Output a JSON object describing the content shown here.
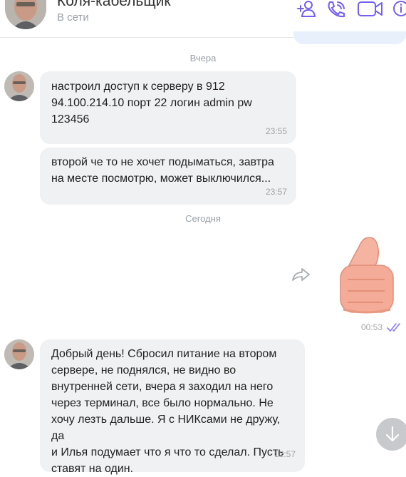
{
  "header": {
    "contact_name": "Коля-кабельщик",
    "status": "В сети",
    "icons": [
      "add-user-icon",
      "phone-icon",
      "video-icon",
      "info-icon"
    ],
    "accent_color": "#7360f2"
  },
  "dates": {
    "yesterday": "Вчера",
    "today": "Сегодня"
  },
  "messages": [
    {
      "text": "настроил доступ к серверу в 912\n94.100.214.10     порт 22     логин admin     pw\n123456",
      "time": "23:55"
    },
    {
      "text": "второй че то не хочет подыматься,   завтра\nна месте посмотрю, может выключился...",
      "time": "23:57"
    },
    {
      "text": "Добрый день! Сбросил питание на втором\nсервере, не поднялся, не видно во\nвнутренней сети, вчера я заходил на него\nчерез терминал, все было нормально. Не\nхочу лезть дальше. Я с НИКсами не дружу, да\nи Илья подумает что я что то сделал. Пусть\nставят на один.",
      "time": "12:57"
    }
  ],
  "outgoing": {
    "sticker": "thumbs-up",
    "time": "00:53",
    "status": "read"
  }
}
